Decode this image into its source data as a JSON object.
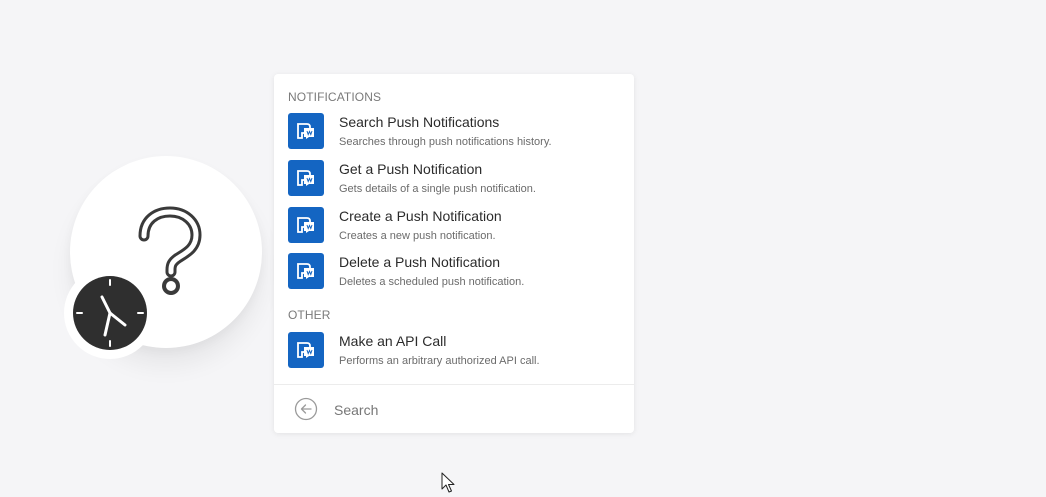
{
  "canvas": {
    "module_icon": "question-mark-icon",
    "trigger_badge_icon": "clock-icon"
  },
  "popup": {
    "sections": [
      {
        "header": "NOTIFICATIONS",
        "items": [
          {
            "title": "Search Push Notifications",
            "description": "Searches through push notifications history.",
            "icon": "pushwoosh-app-icon"
          },
          {
            "title": "Get a Push Notification",
            "description": "Gets details of a single push notification.",
            "icon": "pushwoosh-app-icon"
          },
          {
            "title": "Create a Push Notification",
            "description": "Creates a new push notification.",
            "icon": "pushwoosh-app-icon"
          },
          {
            "title": "Delete a Push Notification",
            "description": "Deletes a scheduled push notification.",
            "icon": "pushwoosh-app-icon"
          }
        ]
      },
      {
        "header": "OTHER",
        "items": [
          {
            "title": "Make an API Call",
            "description": "Performs an arbitrary authorized API call.",
            "icon": "pushwoosh-app-icon"
          }
        ]
      }
    ],
    "search": {
      "placeholder": "Search",
      "back_icon": "back-arrow-icon"
    }
  },
  "colors": {
    "app_icon_bg": "#1465c2",
    "canvas_bg": "#f5f5f7"
  }
}
